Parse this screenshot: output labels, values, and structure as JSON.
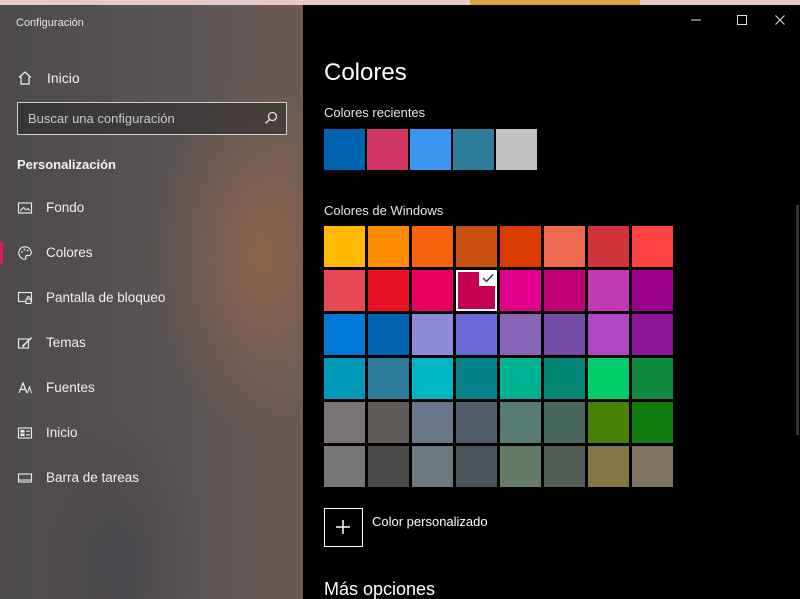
{
  "window": {
    "title": "Configuración",
    "controls": [
      "minimize-icon",
      "maximize-icon",
      "close-icon"
    ]
  },
  "sidebar": {
    "home_label": "Inicio",
    "search_placeholder": "Buscar una configuración",
    "section": "Personalización",
    "items": [
      {
        "label": "Fondo",
        "icon": "picture-icon",
        "active": false
      },
      {
        "label": "Colores",
        "icon": "palette-icon",
        "active": true
      },
      {
        "label": "Pantalla de bloqueo",
        "icon": "lock-screen-icon",
        "active": false
      },
      {
        "label": "Temas",
        "icon": "themes-icon",
        "active": false
      },
      {
        "label": "Fuentes",
        "icon": "fonts-icon",
        "active": false
      },
      {
        "label": "Inicio",
        "icon": "start-icon",
        "active": false
      },
      {
        "label": "Barra de tareas",
        "icon": "taskbar-icon",
        "active": false
      }
    ]
  },
  "main": {
    "title": "Colores",
    "recent_label": "Colores recientes",
    "recent_colors": [
      "#0063b1",
      "#d13565",
      "#3a96f0",
      "#2d7d9a",
      "#c2c2c2"
    ],
    "windows_label": "Colores de Windows",
    "windows_colors": [
      [
        "#ffb900",
        "#ff8c00",
        "#f7630c",
        "#ca5010",
        "#da3b01",
        "#ef6950",
        "#d13438",
        "#ff4343"
      ],
      [
        "#e74856",
        "#e81123",
        "#ea005e",
        "#c30052",
        "#e3008c",
        "#bf0077",
        "#c239b3",
        "#9a0089"
      ],
      [
        "#0078d7",
        "#0063b1",
        "#8e8cd8",
        "#6b69d6",
        "#8764b8",
        "#744da9",
        "#b146c2",
        "#881798"
      ],
      [
        "#0099bc",
        "#2d7d9a",
        "#00b7c3",
        "#038387",
        "#00b294",
        "#018574",
        "#00cc6a",
        "#10893e"
      ],
      [
        "#7a7574",
        "#5d5a58",
        "#68768a",
        "#515c6b",
        "#567c73",
        "#486860",
        "#498205",
        "#107c10"
      ],
      [
        "#767676",
        "#4c4a48",
        "#69797e",
        "#4a5459",
        "#647c64",
        "#525e54",
        "#847545",
        "#7e735f"
      ]
    ],
    "selected": {
      "row": 1,
      "col": 3
    },
    "custom_label": "Color personalizado",
    "more_label": "Más opciones"
  }
}
